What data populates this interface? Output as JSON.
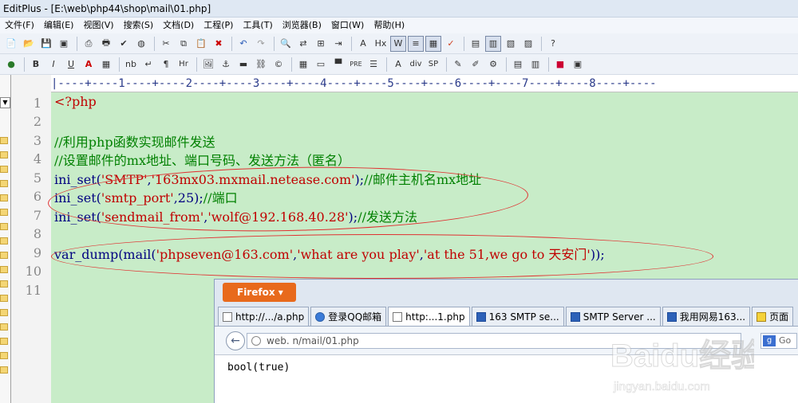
{
  "window": {
    "title": "EditPlus - [E:\\web\\php44\\shop\\mail\\01.php]"
  },
  "menu": [
    "文件(F)",
    "编辑(E)",
    "视图(V)",
    "搜索(S)",
    "文档(D)",
    "工程(P)",
    "工具(T)",
    "浏览器(B)",
    "窗口(W)",
    "帮助(H)"
  ],
  "toolbar2": {
    "bold": "B",
    "italic": "I",
    "underline": "U",
    "font_color": "A",
    "nb": "nb",
    "para": "¶",
    "hr": "Hr",
    "pre": "PRE",
    "div": "div",
    "sp": "SP"
  },
  "ruler": "|----+----1----+----2----+----3----+----4----+----5----+----6----+----7----+----8----+----",
  "line_numbers": [
    "1",
    "2",
    "3",
    "4",
    "5",
    "6",
    "7",
    "8",
    "9",
    "10",
    "11"
  ],
  "code": {
    "l1": "<?php",
    "l3": "//利用php函数实现邮件发送",
    "l4": "//设置邮件的mx地址、端口号码、发送方法（匿名）",
    "l5_fn": "ini_set(",
    "l5_a": "'SMTP'",
    "l5_c": ",",
    "l5_b": "'163mx03.mxmail.netease.com'",
    "l5_e": ");",
    "l5_cm": "//邮件主机名mx地址",
    "l6_fn": "ini_set(",
    "l6_a": "'smtp_port'",
    "l6_b": ",25);",
    "l6_cm": "//端口",
    "l7_fn": "ini_set(",
    "l7_a": "'sendmail_from'",
    "l7_c": ",",
    "l7_b": "'wolf@192.168.40.28'",
    "l7_e": ");",
    "l7_cm": "//发送方法",
    "l9_fn": "var_dump(mail(",
    "l9_a": "'phpseven@163.com'",
    "l9_c1": ",",
    "l9_b": "'what are you play'",
    "l9_c2": ",",
    "l9_d": "'at the 51,we go to 天安门'",
    "l9_e": "));"
  },
  "firefox": {
    "button": "Firefox",
    "tabs": [
      "http://.../a.php",
      "登录QQ邮箱",
      "http:...1.php",
      "163 SMTP se...",
      "SMTP Server ...",
      "我用网易163...",
      "页面"
    ],
    "url": "web.          n/mail/01.php",
    "search": "Go",
    "output": "bool(true)"
  },
  "watermark": {
    "brand": "Baidu经验",
    "site": "jingyan.baidu.com"
  }
}
